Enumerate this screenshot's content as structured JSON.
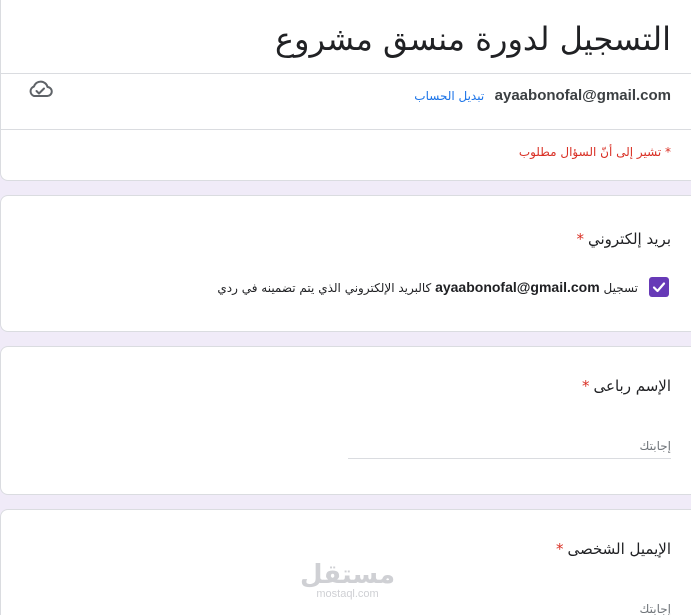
{
  "form": {
    "title": "التسجيل لدورة منسق مشروع",
    "account_email": "ayaabonofal@gmail.com",
    "switch_account": "تبديل الحساب",
    "required_note": "* تشير إلى أنّ السؤال مطلوب"
  },
  "questions": {
    "email": {
      "title": "بريد إلكتروني",
      "required_mark": "*",
      "checkbox_prefix": "تسجيل",
      "checkbox_email": "ayaabonofal@gmail.com",
      "checkbox_suffix": "كالبريد الإلكتروني الذي يتم تضمينه في ردي",
      "checked": true
    },
    "full_name": {
      "title": "الإسم رباعى",
      "required_mark": "*",
      "placeholder": "إجابتك"
    },
    "personal_email": {
      "title": "الإيميل الشخصى",
      "required_mark": "*",
      "placeholder": "إجابتك"
    }
  },
  "watermark": {
    "main": "مستقل",
    "sub": "mostaql.com"
  },
  "colors": {
    "accent": "#673ab7",
    "background": "#f0ebf8",
    "required": "#d93025",
    "link": "#1a73e8"
  },
  "icons": {
    "cloud": "cloud-saved-icon",
    "check": "check-icon"
  }
}
